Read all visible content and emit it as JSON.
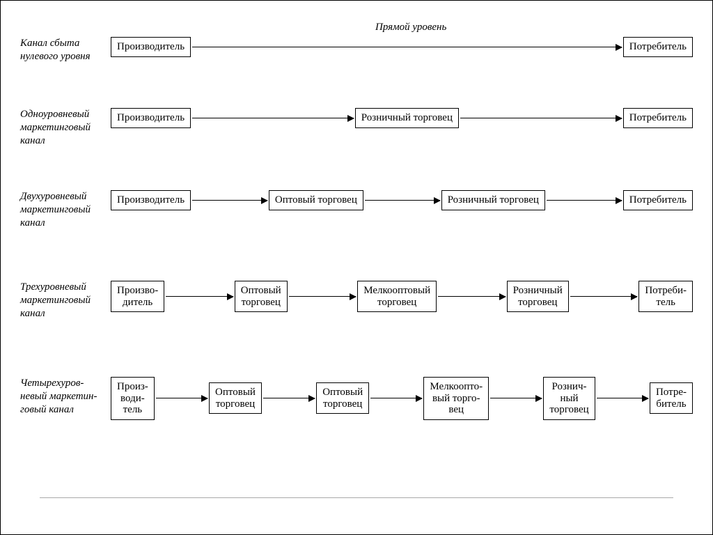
{
  "rows": [
    {
      "label": "Канал сбыта нулевого уровня",
      "caption": "Прямой уровень",
      "nodes": [
        "Производитель",
        "Потребитель"
      ]
    },
    {
      "label": "Одноуровневый маркетинговый канал",
      "nodes": [
        "Производитель",
        "Розничный торговец",
        "Потребитель"
      ]
    },
    {
      "label": "Двухуровневый маркетинговый канал",
      "nodes": [
        "Производитель",
        "Оптовый торговец",
        "Розничный торговец",
        "Потребитель"
      ]
    },
    {
      "label": "Трехуровневый маркетинговый канал",
      "nodes": [
        "Произво-\nдитель",
        "Оптовый\nторговец",
        "Мелкооптовый\nторговец",
        "Розничный\nторговец",
        "Потреби-\nтель"
      ]
    },
    {
      "label": "Четырехуров-невый маркетин-говый канал",
      "nodes": [
        "Произ-\nводи-\nтель",
        "Оптовый\nторговец",
        "Оптовый\nторговец",
        "Мелкоопто-\nвый торго-\nвец",
        "Рознич-\nный\nторговец",
        "Потре-\nбитель"
      ]
    }
  ]
}
